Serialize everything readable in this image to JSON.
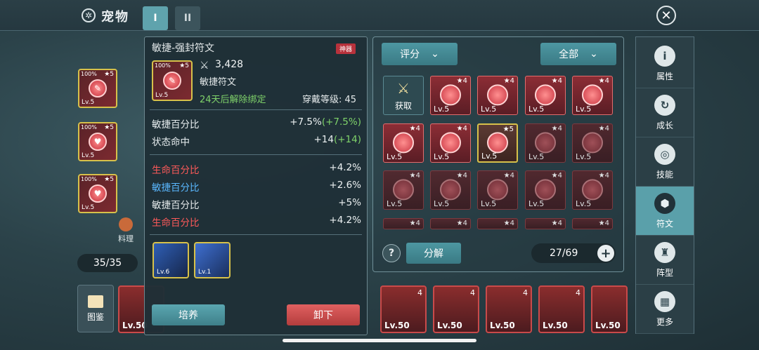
{
  "header": {
    "title": "宠物",
    "tabs": [
      "I",
      "II"
    ],
    "close_label": "✕"
  },
  "equipped": [
    {
      "pct": "100%",
      "star": "★5",
      "lv": "Lv.5"
    },
    {
      "pct": "100%",
      "star": "★5",
      "lv": "Lv.5"
    },
    {
      "pct": "100%",
      "star": "★5",
      "lv": "Lv.5"
    }
  ],
  "cook_label": "料理",
  "count_left": "35/35",
  "codex_label": "图鉴",
  "pets": [
    {
      "lv": "Lv.50",
      "star": "4"
    },
    {
      "lv": "Lv.50",
      "star": "4"
    },
    {
      "lv": "Lv.50",
      "star": "4"
    },
    {
      "lv": "Lv.50",
      "star": "4"
    },
    {
      "lv": "Lv.50",
      "star": "4"
    },
    {
      "lv": "Lv.50",
      "star": "4"
    }
  ],
  "tooltip": {
    "name": "敏捷-强封符文",
    "badge": "神器",
    "pct": "100%",
    "star": "★5",
    "lv": "Lv.5",
    "power": "3,428",
    "type": "敏捷符文",
    "unbind": "24天后解除绑定",
    "wear_level": "穿戴等级: 45",
    "main_stats": [
      {
        "name": "敏捷百分比",
        "value": "+7.5%",
        "inc": "(+7.5%)"
      },
      {
        "name": "状态命中",
        "value": "+14",
        "inc": "(+14)"
      }
    ],
    "sub_stats": [
      {
        "name": "生命百分比",
        "value": "+4.2%",
        "color": "#ff5a5a"
      },
      {
        "name": "敏捷百分比",
        "value": "+2.6%",
        "color": "#5ab8ff"
      },
      {
        "name": "敏捷百分比",
        "value": "+5%",
        "color": "#e5eaeb"
      },
      {
        "name": "生命百分比",
        "value": "+4.2%",
        "color": "#ff5a5a"
      }
    ],
    "skills": [
      {
        "lv": "Lv.6"
      },
      {
        "lv": "Lv.1"
      }
    ],
    "btn_cultivate": "培养",
    "btn_unequip": "卸下"
  },
  "filters": {
    "sort": "评分",
    "category": "全部"
  },
  "acquire_label": "获取",
  "grid": [
    {
      "star": "★4",
      "lv": "Lv.5",
      "style": "bright"
    },
    {
      "star": "★4",
      "lv": "Lv.5",
      "style": "bright"
    },
    {
      "star": "★4",
      "lv": "Lv.5",
      "style": "bright"
    },
    {
      "star": "★4",
      "lv": "Lv.5",
      "style": "bright"
    },
    {
      "star": "★4",
      "lv": "Lv.5",
      "style": "bright"
    },
    {
      "star": "★4",
      "lv": "Lv.5",
      "style": "bright"
    },
    {
      "star": "★5",
      "lv": "Lv.5",
      "style": "gold"
    },
    {
      "star": "★4",
      "lv": "Lv.5",
      "style": "dim"
    },
    {
      "star": "★4",
      "lv": "Lv.5",
      "style": "dim"
    },
    {
      "star": "★4",
      "lv": "Lv.5",
      "style": "dim"
    },
    {
      "star": "★4",
      "lv": "Lv.5",
      "style": "dim"
    },
    {
      "star": "★4",
      "lv": "Lv.5",
      "style": "dim"
    },
    {
      "star": "★4",
      "lv": "Lv.5",
      "style": "dim"
    },
    {
      "star": "★4",
      "lv": "Lv.5",
      "style": "dim"
    },
    {
      "star": "★4",
      "lv": "",
      "style": "dim"
    },
    {
      "star": "★4",
      "lv": "",
      "style": "dim"
    },
    {
      "star": "★4",
      "lv": "",
      "style": "dim"
    },
    {
      "star": "★4",
      "lv": "",
      "style": "dim"
    },
    {
      "star": "★4",
      "lv": "",
      "style": "dim"
    }
  ],
  "bottom": {
    "help": "?",
    "decompose": "分解",
    "capacity": "27/69",
    "plus": "+"
  },
  "sidebar": [
    {
      "label": "属性",
      "icon": "i"
    },
    {
      "label": "成长",
      "icon": "↻"
    },
    {
      "label": "技能",
      "icon": "◎"
    },
    {
      "label": "符文",
      "icon": "⬢"
    },
    {
      "label": "阵型",
      "icon": "♜"
    },
    {
      "label": "更多",
      "icon": "▦"
    }
  ]
}
